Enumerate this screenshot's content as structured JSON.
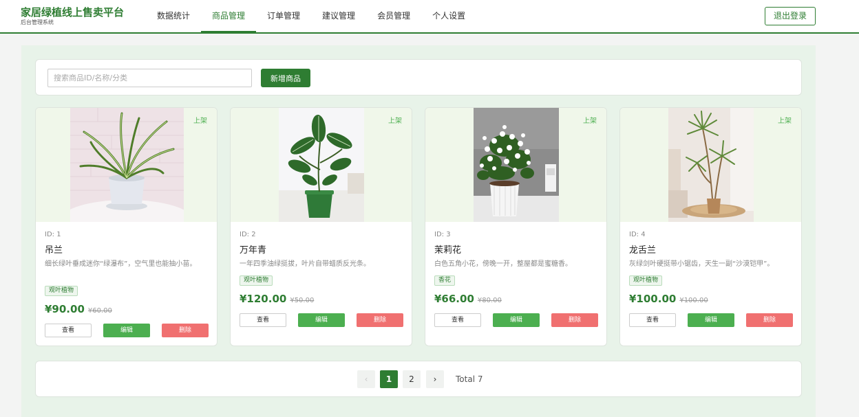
{
  "header": {
    "brand_title": "家居绿植线上售卖平台",
    "brand_subtitle": "后台管理系统",
    "nav": [
      {
        "label": "数据统计",
        "active": false
      },
      {
        "label": "商品管理",
        "active": true
      },
      {
        "label": "订单管理",
        "active": false
      },
      {
        "label": "建议管理",
        "active": false
      },
      {
        "label": "会员管理",
        "active": false
      },
      {
        "label": "个人设置",
        "active": false
      }
    ],
    "logout_label": "退出登录"
  },
  "toolbar": {
    "search_placeholder": "搜索商品ID/名称/分类",
    "search_value": "",
    "add_label": "新增商品"
  },
  "products": [
    {
      "id_text": "ID: 1",
      "name": "吊兰",
      "desc": "细长绿叶垂成迷你“绿瀑布”，空气里也能抽小苗。",
      "tag": "观叶植物",
      "price": "¥90.00",
      "orig_price": "¥60.00",
      "status": "上架",
      "view": "查看",
      "edit": "编辑",
      "del": "删除"
    },
    {
      "id_text": "ID: 2",
      "name": "万年青",
      "desc": "一年四季油绿挺拔，叶片自带蜡质反光条。",
      "tag": "观叶植物",
      "price": "¥120.00",
      "orig_price": "¥50.00",
      "status": "上架",
      "view": "查看",
      "edit": "编辑",
      "del": "删除"
    },
    {
      "id_text": "ID: 3",
      "name": "茉莉花",
      "desc": "白色五角小花，傍晚一开，整屋都是蜜糖香。",
      "tag": "香花",
      "price": "¥66.00",
      "orig_price": "¥80.00",
      "status": "上架",
      "view": "查看",
      "edit": "编辑",
      "del": "删除"
    },
    {
      "id_text": "ID: 4",
      "name": "龙舌兰",
      "desc": "灰绿剑叶硬挺带小锯齿，天生一副“沙漠铠甲”。",
      "tag": "观叶植物",
      "price": "¥100.00",
      "orig_price": "¥100.00",
      "status": "上架",
      "view": "查看",
      "edit": "编辑",
      "del": "删除"
    }
  ],
  "pagination": {
    "prev": "‹",
    "pages": [
      "1",
      "2"
    ],
    "current": "1",
    "next": "›",
    "total": "Total 7"
  },
  "colors": {
    "brand": "#2e7d32",
    "edit": "#4caf50",
    "delete": "#f07070",
    "main_bg": "#e8f3e9"
  }
}
